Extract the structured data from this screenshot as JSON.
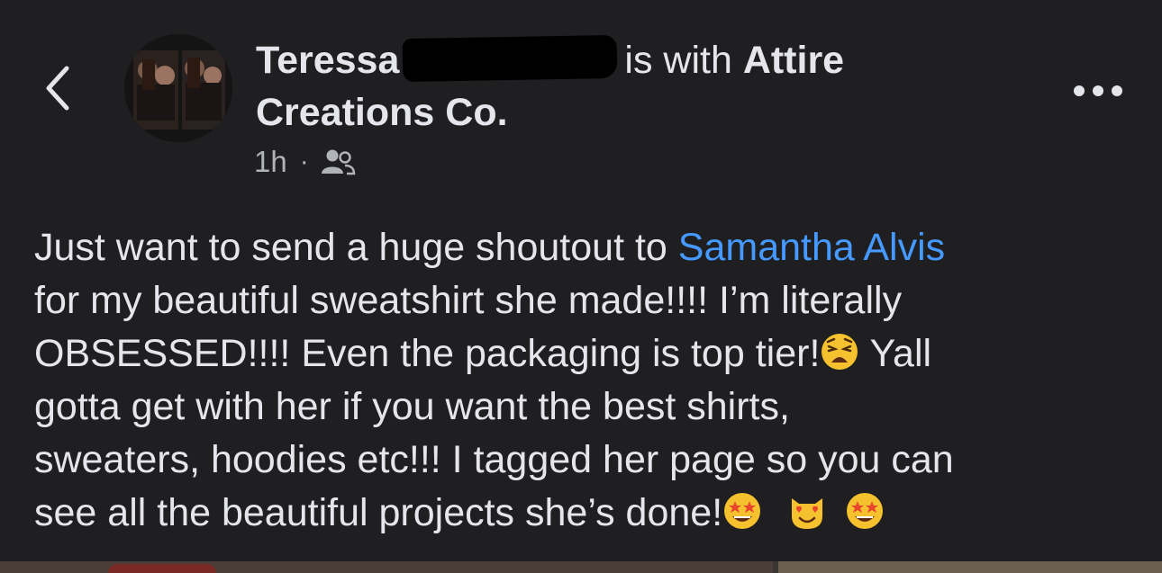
{
  "post": {
    "author_first": "Teressa",
    "with_text": "is with",
    "page_name_part1": "Attire",
    "page_name_part2": "Creations Co.",
    "time": "1h",
    "dot": "·",
    "audience_icon": "friends-icon",
    "body": {
      "line1_before": "Just want to send a huge shoutout to ",
      "mention": "Samantha Alvis",
      "line2": "for my beautiful sweatshirt she made!!!! I’m literally",
      "line3_before": "OBSESSED!!!! Even the packaging is top tier!",
      "line3_after": " Yall",
      "line4": "gotta get with her if you want the best shirts,",
      "line5": "sweaters, hoodies etc!!! I tagged her page so you can",
      "line6": "see all the beautiful projects she’s done!"
    },
    "emojis": [
      "weary-face",
      "star-struck",
      "heart-eyes-cat",
      "star-struck"
    ]
  },
  "colors": {
    "background": "#1f1f21",
    "text": "#e4e6eb",
    "secondary_text": "#b0b3b8",
    "link": "#4599ff"
  },
  "icons": {
    "back": "chevron-left-icon",
    "more": "more-horizontal-icon"
  }
}
